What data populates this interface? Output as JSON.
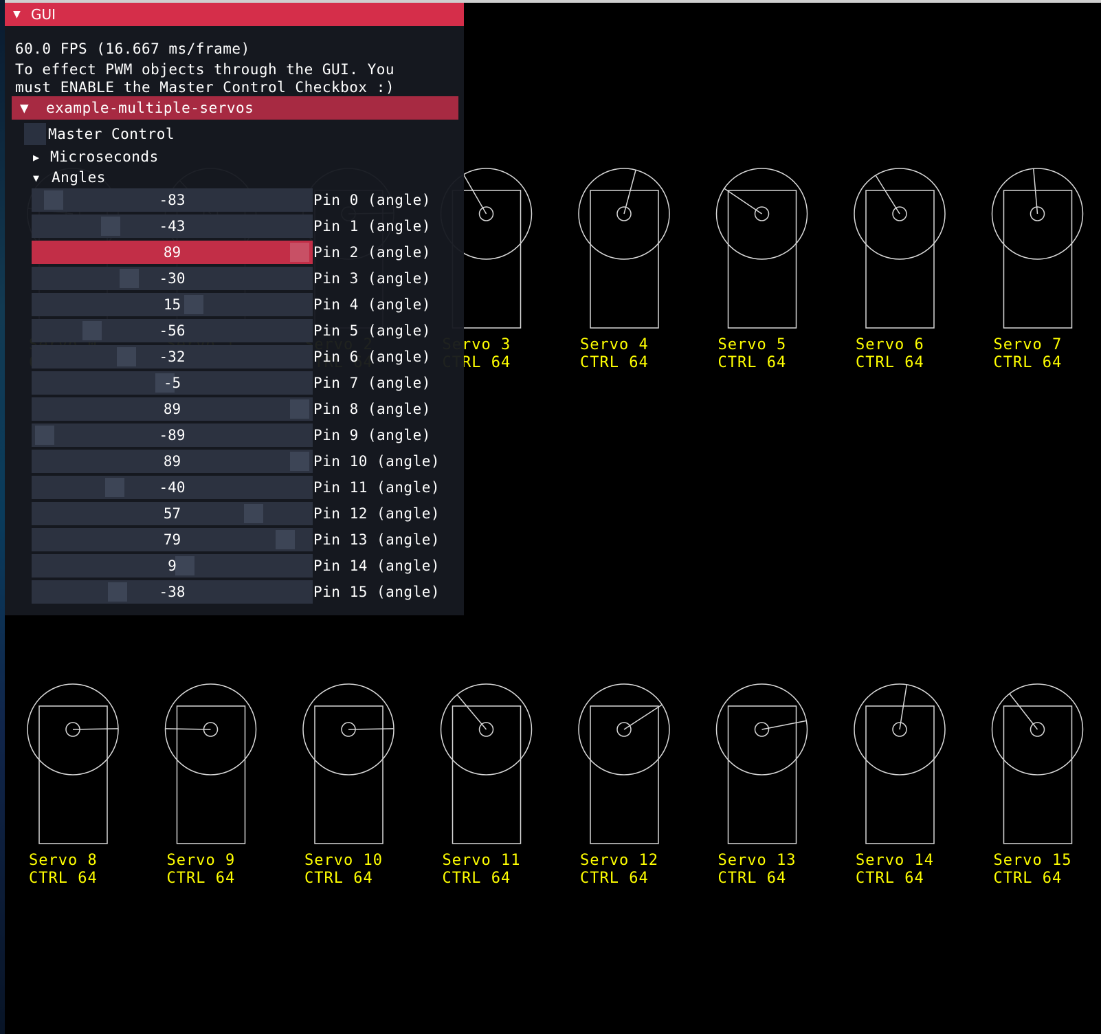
{
  "gui": {
    "title": "GUI",
    "fps_text": "60.0 FPS (16.667 ms/frame)",
    "note_line1": "To effect PWM objects through the GUI. You",
    "note_line2": "must ENABLE the Master Control Checkbox :)",
    "folder": "example-multiple-servos",
    "master_control_label": "Master Control",
    "master_control_checked": false,
    "microseconds_label": "Microseconds",
    "angles_label": "Angles",
    "slider_min": -90,
    "slider_max": 90,
    "active_slider_index": 2,
    "sliders": [
      {
        "value": "-83",
        "label": "Pin 0 (angle)"
      },
      {
        "value": "-43",
        "label": "Pin 1 (angle)"
      },
      {
        "value": "89",
        "label": "Pin 2 (angle)"
      },
      {
        "value": "-30",
        "label": "Pin 3 (angle)"
      },
      {
        "value": "15",
        "label": "Pin 4 (angle)"
      },
      {
        "value": "-56",
        "label": "Pin 5 (angle)"
      },
      {
        "value": "-32",
        "label": "Pin 6 (angle)"
      },
      {
        "value": "-5",
        "label": "Pin 7 (angle)"
      },
      {
        "value": "89",
        "label": "Pin 8 (angle)"
      },
      {
        "value": "-89",
        "label": "Pin 9 (angle)"
      },
      {
        "value": "89",
        "label": "Pin 10 (angle)"
      },
      {
        "value": "-40",
        "label": "Pin 11 (angle)"
      },
      {
        "value": "57",
        "label": "Pin 12 (angle)"
      },
      {
        "value": "79",
        "label": "Pin 13 (angle)"
      },
      {
        "value": "9",
        "label": "Pin 14 (angle)"
      },
      {
        "value": "-38",
        "label": "Pin 15 (angle)"
      }
    ]
  },
  "servos": [
    {
      "name": "Servo 0",
      "ctrl": "CTRL 64",
      "angle": -83
    },
    {
      "name": "Servo 1",
      "ctrl": "CTRL 64",
      "angle": -43
    },
    {
      "name": "Servo 2",
      "ctrl": "CTRL 64",
      "angle": 89
    },
    {
      "name": "Servo 3",
      "ctrl": "CTRL 64",
      "angle": -30
    },
    {
      "name": "Servo 4",
      "ctrl": "CTRL 64",
      "angle": 15
    },
    {
      "name": "Servo 5",
      "ctrl": "CTRL 64",
      "angle": -56
    },
    {
      "name": "Servo 6",
      "ctrl": "CTRL 64",
      "angle": -32
    },
    {
      "name": "Servo 7",
      "ctrl": "CTRL 64",
      "angle": -5
    },
    {
      "name": "Servo 8",
      "ctrl": "CTRL 64",
      "angle": 89
    },
    {
      "name": "Servo 9",
      "ctrl": "CTRL 64",
      "angle": -89
    },
    {
      "name": "Servo 10",
      "ctrl": "CTRL 64",
      "angle": 89
    },
    {
      "name": "Servo 11",
      "ctrl": "CTRL 64",
      "angle": -40
    },
    {
      "name": "Servo 12",
      "ctrl": "CTRL 64",
      "angle": 57
    },
    {
      "name": "Servo 13",
      "ctrl": "CTRL 64",
      "angle": 79
    },
    {
      "name": "Servo 14",
      "ctrl": "CTRL 64",
      "angle": 9
    },
    {
      "name": "Servo 15",
      "ctrl": "CTRL 64",
      "angle": -38
    }
  ],
  "colors": {
    "accent": "#d52e4a",
    "folder": "#a72a42",
    "label": "#ffff00",
    "servo_stroke": "#d8d8d8"
  }
}
